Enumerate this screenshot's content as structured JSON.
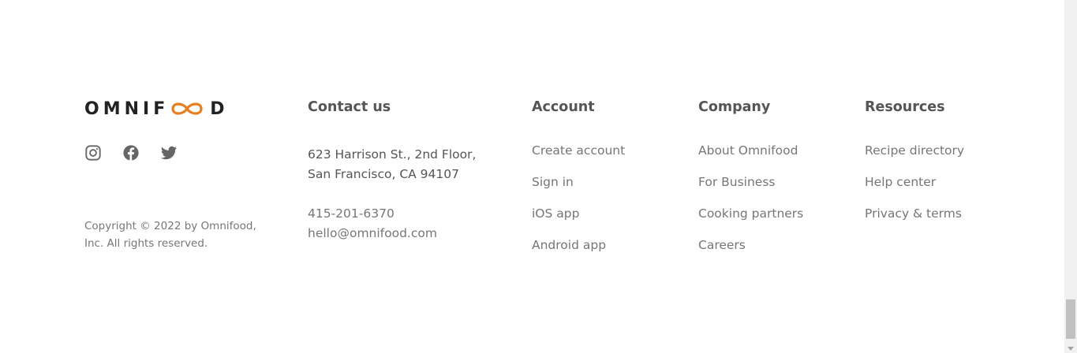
{
  "brand": {
    "logo_left": "OMNIF",
    "logo_right": "D",
    "accent_color": "#e67e22"
  },
  "socials": [
    {
      "icon": "instagram-icon"
    },
    {
      "icon": "facebook-icon"
    },
    {
      "icon": "twitter-icon"
    }
  ],
  "copyright": "Copyright © 2022 by Omnifood, Inc. All rights reserved.",
  "contact": {
    "title": "Contact us",
    "address_line1": "623 Harrison St., 2nd Floor,",
    "address_line2": "San Francisco, CA 94107",
    "phone": "415-201-6370",
    "email": "hello@omnifood.com"
  },
  "account": {
    "title": "Account",
    "links": [
      "Create account",
      "Sign in",
      "iOS app",
      "Android app"
    ]
  },
  "company": {
    "title": "Company",
    "links": [
      "About Omnifood",
      "For Business",
      "Cooking partners",
      "Careers"
    ]
  },
  "resources": {
    "title": "Resources",
    "links": [
      "Recipe directory",
      "Help center",
      "Privacy & terms"
    ]
  }
}
